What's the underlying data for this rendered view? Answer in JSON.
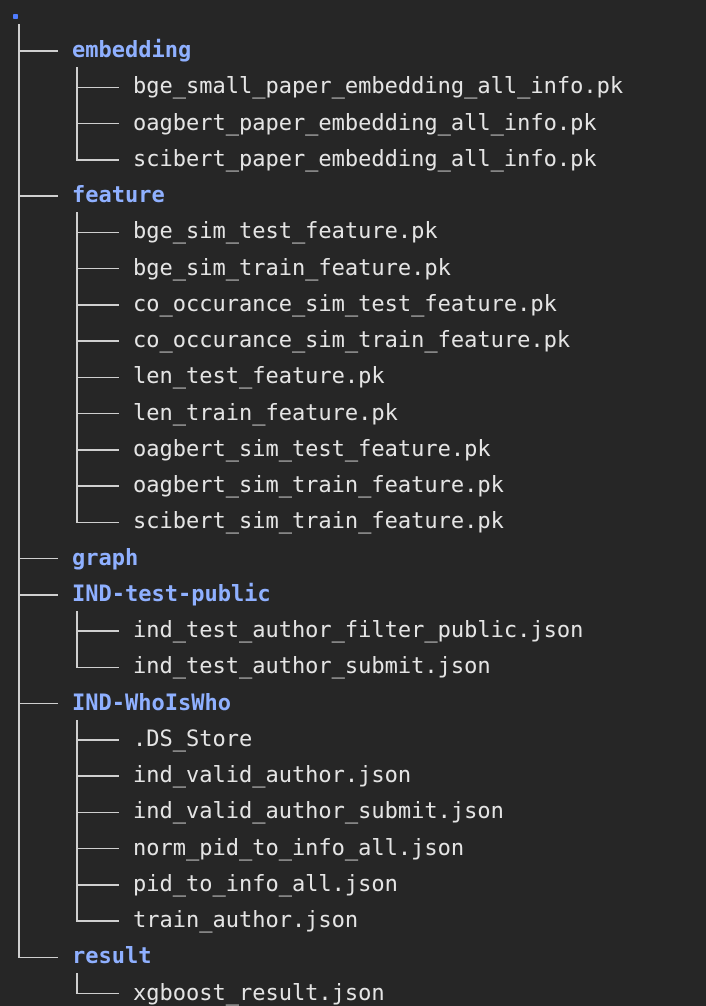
{
  "tree": {
    "root": ".",
    "dirs": [
      {
        "name": "embedding",
        "files": [
          "bge_small_paper_embedding_all_info.pk",
          "oagbert_paper_embedding_all_info.pk",
          "scibert_paper_embedding_all_info.pk"
        ]
      },
      {
        "name": "feature",
        "files": [
          "bge_sim_test_feature.pk",
          "bge_sim_train_feature.pk",
          "co_occurance_sim_test_feature.pk",
          "co_occurance_sim_train_feature.pk",
          "len_test_feature.pk",
          "len_train_feature.pk",
          "oagbert_sim_test_feature.pk",
          "oagbert_sim_train_feature.pk",
          "scibert_sim_train_feature.pk"
        ]
      },
      {
        "name": "graph",
        "files": []
      },
      {
        "name": "IND-test-public",
        "files": [
          "ind_test_author_filter_public.json",
          "ind_test_author_submit.json"
        ]
      },
      {
        "name": "IND-WhoIsWho",
        "files": [
          ".DS_Store",
          "ind_valid_author.json",
          "ind_valid_author_submit.json",
          "norm_pid_to_info_all.json",
          "pid_to_info_all.json",
          "train_author.json"
        ]
      },
      {
        "name": "result",
        "files": [
          "xgboost_result.json"
        ]
      }
    ]
  },
  "colors": {
    "background": "#262626",
    "directory": "#8fb0ff",
    "file": "#e4e4e4",
    "guide": "#cfcfcf",
    "root_dot": "#4f7cff"
  }
}
